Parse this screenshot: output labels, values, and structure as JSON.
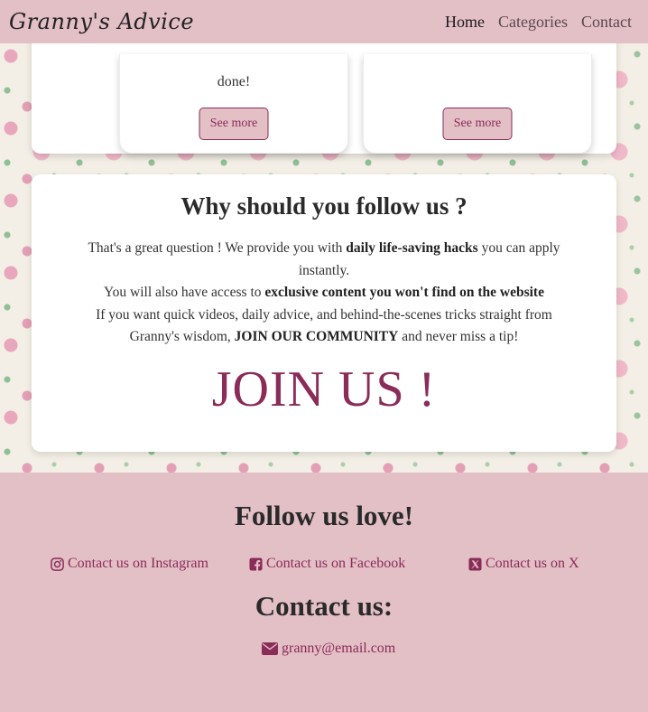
{
  "navbar": {
    "brand": "Granny's Advice",
    "links": [
      {
        "label": "Home"
      },
      {
        "label": "Categories"
      },
      {
        "label": "Contact"
      }
    ]
  },
  "top_cards": [
    {
      "text": "done!",
      "button": "See more"
    },
    {
      "text": "",
      "button": "See more"
    }
  ],
  "why": {
    "title": "Why should you follow us ?",
    "line1_a": "That's a great question ! We provide you with ",
    "line1_b": "daily life-saving hacks",
    "line1_c": " you can apply instantly.",
    "line2_a": "You will also have access to ",
    "line2_b": "exclusive content you won't find on the website",
    "line3_a": "If you want quick videos, daily advice, and behind-the-scenes tricks straight from Granny's wisdom, ",
    "line3_b": "JOIN OUR COMMUNITY",
    "line3_c": " and never miss a tip!",
    "join": "JOIN US !"
  },
  "footer": {
    "follow_title": "Follow us love!",
    "socials": [
      {
        "label": "Contact us on Instagram",
        "icon": "instagram-icon"
      },
      {
        "label": "Contact us on Facebook",
        "icon": "facebook-icon"
      },
      {
        "label": "Contact us on X",
        "icon": "x-icon"
      }
    ],
    "contact_title": "Contact us:",
    "email": "granny@email.com",
    "email_icon": "envelope-icon"
  },
  "colors": {
    "accent": "#8a2c58",
    "nav_bg": "#e3bfc6"
  }
}
